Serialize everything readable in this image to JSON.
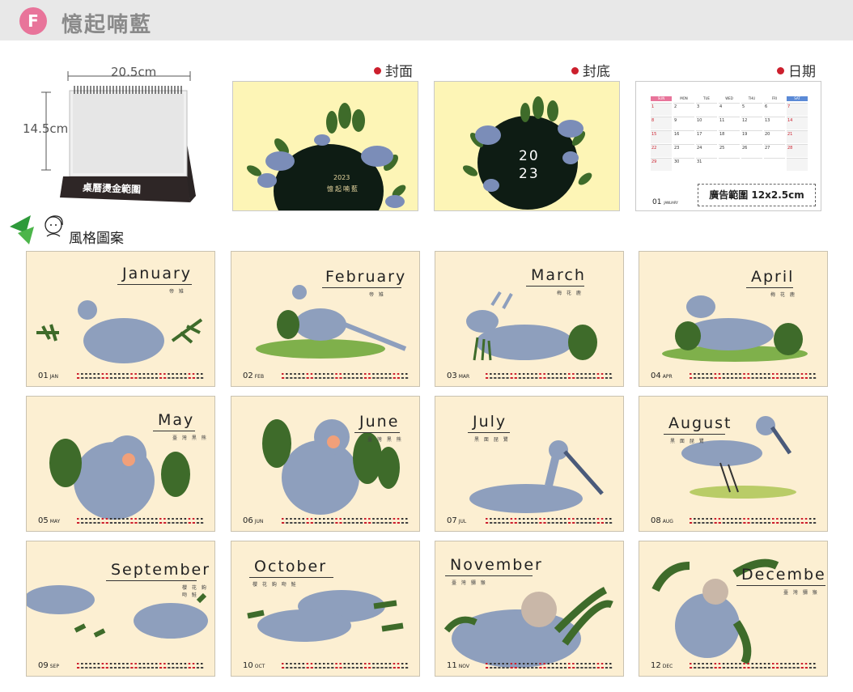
{
  "header": {
    "badge": "F",
    "title": "憶起喃藍"
  },
  "product": {
    "width_label": "20.5cm",
    "height_label": "14.5cm",
    "base_label": "桌曆燙金範圍"
  },
  "previews": {
    "cover": {
      "label": "封面",
      "year": "2023",
      "title": "憶起喃藍"
    },
    "back": {
      "label": "封底",
      "year_top": "20",
      "year_bottom": "23"
    },
    "date": {
      "label": "日期",
      "weekdays": [
        "SUN",
        "MON",
        "TUE",
        "WED",
        "THU",
        "FRI",
        "SAT"
      ],
      "dates": [
        [
          "1",
          "2",
          "3",
          "4",
          "5",
          "6",
          "7"
        ],
        [
          "8",
          "9",
          "10",
          "11",
          "12",
          "13",
          "14"
        ],
        [
          "15",
          "16",
          "17",
          "18",
          "19",
          "20",
          "21"
        ],
        [
          "22",
          "23",
          "24",
          "25",
          "26",
          "27",
          "28"
        ],
        [
          "29",
          "30",
          "31",
          "",
          "",
          "",
          ""
        ]
      ],
      "footer_num": "01",
      "footer_month": "JANUARY",
      "ad_label": "廣告範圍 12x2.5cm"
    }
  },
  "section": {
    "title": "風格圖案"
  },
  "months": [
    {
      "name": "January",
      "sub": "帝 雉",
      "num": "01",
      "abbr": "JAN"
    },
    {
      "name": "February",
      "sub": "帝 雉",
      "num": "02",
      "abbr": "FEB"
    },
    {
      "name": "March",
      "sub": "梅 花 鹿",
      "num": "03",
      "abbr": "MAR"
    },
    {
      "name": "April",
      "sub": "梅 花 鹿",
      "num": "04",
      "abbr": "APR"
    },
    {
      "name": "May",
      "sub": "臺 灣 黑 熊",
      "num": "05",
      "abbr": "MAY"
    },
    {
      "name": "June",
      "sub": "臺 灣 黑 熊",
      "num": "06",
      "abbr": "JUN"
    },
    {
      "name": "July",
      "sub": "黑 面 琵 鷺",
      "num": "07",
      "abbr": "JUL"
    },
    {
      "name": "August",
      "sub": "黑 面 琵 鷺",
      "num": "08",
      "abbr": "AUG"
    },
    {
      "name": "September",
      "sub": "櫻 花 鉤 吻 鮭",
      "num": "09",
      "abbr": "SEP"
    },
    {
      "name": "October",
      "sub": "櫻 花 鉤 吻 鮭",
      "num": "10",
      "abbr": "OCT"
    },
    {
      "name": "November",
      "sub": "臺 灣 獼 猴",
      "num": "11",
      "abbr": "NOV"
    },
    {
      "name": "December",
      "sub": "臺 灣 獼 猴",
      "num": "12",
      "abbr": "DEC"
    }
  ],
  "colors": {
    "card_bg": "#fcefd2",
    "preview_bg": "#fdf5b6",
    "animal_blue": "#8e9fbd",
    "leaf_green": "#3e6b2a",
    "accent_red": "#cc1f2d",
    "badge_pink": "#e8749a"
  }
}
